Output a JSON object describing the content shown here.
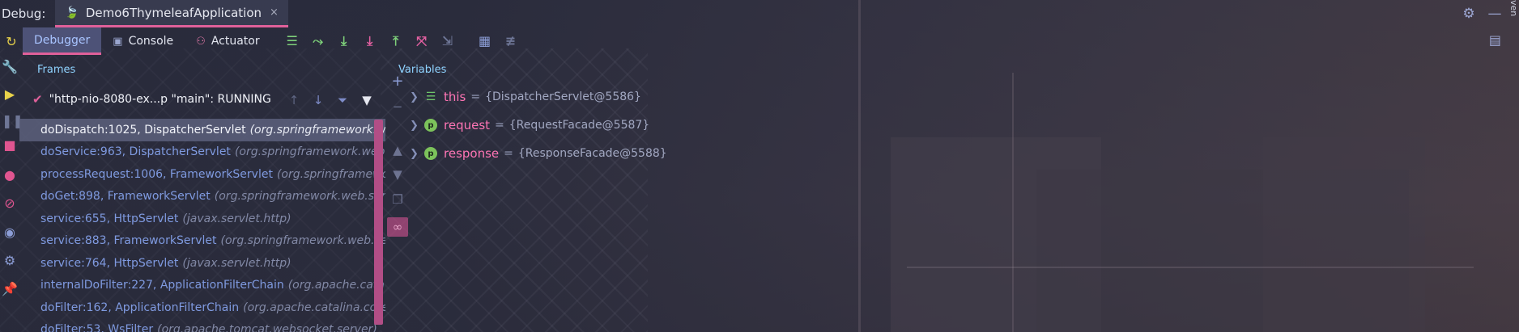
{
  "titlebar": {
    "debug_label": "Debug:",
    "run_tab": "Demo6ThymeleafApplication",
    "close_glyph": "×",
    "side_text": "ven"
  },
  "toolbar": {
    "tabs": [
      {
        "label": "Debugger",
        "icon": "debugger-icon",
        "active": true
      },
      {
        "label": "Console",
        "icon": "console-icon",
        "active": false
      },
      {
        "label": "Actuator",
        "icon": "actuator-icon",
        "active": false
      }
    ]
  },
  "frames": {
    "title": "Frames",
    "thread": "\"http-nio-8080-ex...p \"main\": RUNNING",
    "items": [
      {
        "method": "doDispatch:1025, DispatcherServlet",
        "pkg": "(org.springframework.web"
      },
      {
        "method": "doService:963, DispatcherServlet",
        "pkg": "(org.springframework.web."
      },
      {
        "method": "processRequest:1006, FrameworkServlet",
        "pkg": "(org.springframewo"
      },
      {
        "method": "doGet:898, FrameworkServlet",
        "pkg": "(org.springframework.web.ser"
      },
      {
        "method": "service:655, HttpServlet",
        "pkg": "(javax.servlet.http)"
      },
      {
        "method": "service:883, FrameworkServlet",
        "pkg": "(org.springframework.web.se"
      },
      {
        "method": "service:764, HttpServlet",
        "pkg": "(javax.servlet.http)"
      },
      {
        "method": "internalDoFilter:227, ApplicationFilterChain",
        "pkg": "(org.apache.cata"
      },
      {
        "method": "doFilter:162, ApplicationFilterChain",
        "pkg": "(org.apache.catalina.core"
      },
      {
        "method": "doFilter:53, WsFilter",
        "pkg": "(org.apache.tomcat.websocket.server)"
      }
    ]
  },
  "variables": {
    "title": "Variables",
    "items": [
      {
        "name": "this",
        "value": "{DispatcherServlet@5586}",
        "icon": "field-icon"
      },
      {
        "name": "request",
        "value": "{RequestFacade@5587}",
        "icon": "p"
      },
      {
        "name": "response",
        "value": "{ResponseFacade@5588}",
        "icon": "p"
      }
    ]
  },
  "colors": {
    "accent_pink": "#e0609a",
    "active_tab_text": "#a8c4ff",
    "var_name": "#ff75b5",
    "frame_method": "#7f9ae0"
  }
}
